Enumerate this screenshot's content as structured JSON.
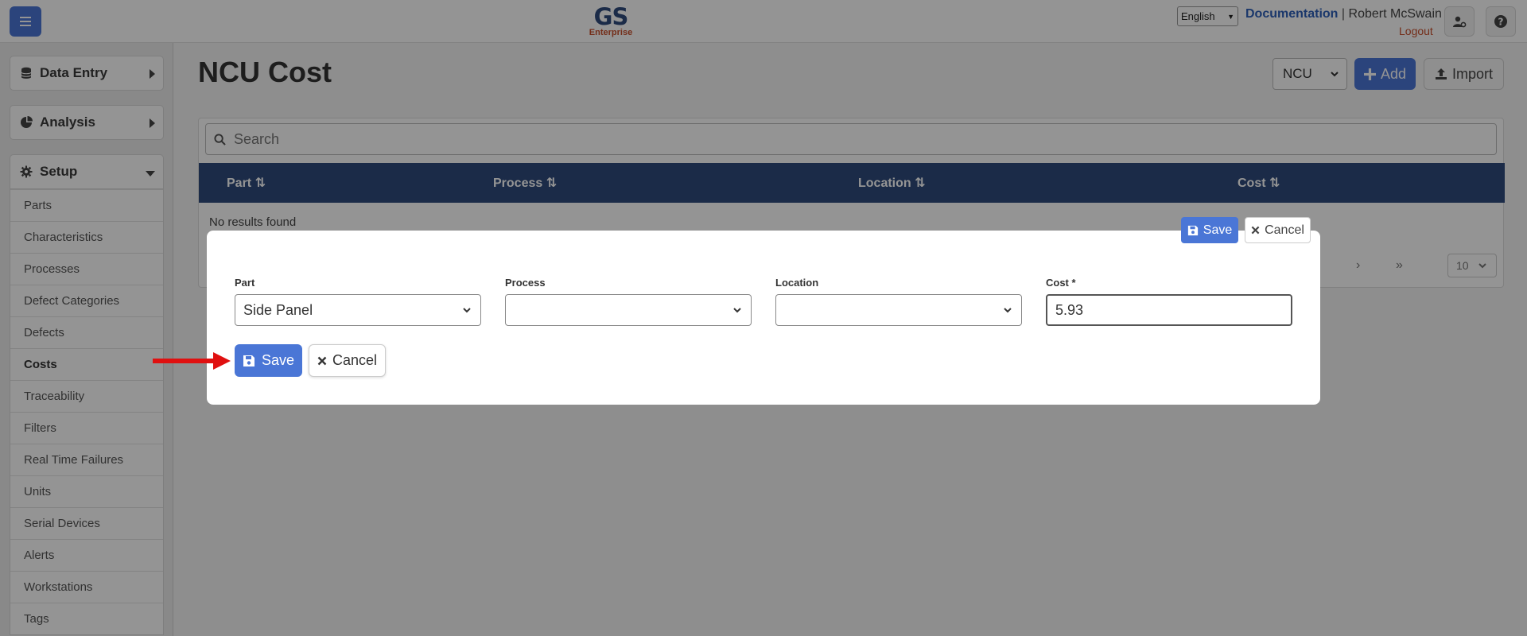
{
  "header": {
    "logo_main": "GS",
    "logo_sub": "Enterprise",
    "language": "English",
    "documentation": "Documentation",
    "separator": "|",
    "user_name": "Robert McSwain",
    "logout": "Logout"
  },
  "sidebar": {
    "groups": {
      "data_entry": "Data Entry",
      "analysis": "Analysis",
      "setup": "Setup"
    },
    "items": [
      "Parts",
      "Characteristics",
      "Processes",
      "Defect Categories",
      "Defects",
      "Costs",
      "Traceability",
      "Filters",
      "Real Time Failures",
      "Units",
      "Serial Devices",
      "Alerts",
      "Workstations",
      "Tags"
    ],
    "active_item": "Costs"
  },
  "main": {
    "title": "NCU Cost",
    "type_select": "NCU",
    "add_label": "Add",
    "import_label": "Import",
    "search_placeholder": "Search",
    "columns": [
      "Part",
      "Process",
      "Location",
      "Cost"
    ],
    "no_results": "No results found",
    "pager_next": "›",
    "pager_last": "»",
    "page_size": "10"
  },
  "modal": {
    "top_save": "Save",
    "top_cancel": "Cancel",
    "fields": {
      "part": {
        "label": "Part",
        "value": "Side Panel"
      },
      "process": {
        "label": "Process",
        "value": ""
      },
      "location": {
        "label": "Location",
        "value": ""
      },
      "cost": {
        "label": "Cost *",
        "value": "5.93"
      }
    },
    "save": "Save",
    "cancel": "Cancel"
  },
  "colors": {
    "primary": "#4a76d6",
    "header_navy": "#2f4b7c",
    "accent_orange": "#c8502d",
    "arrow_red": "#e01010"
  }
}
